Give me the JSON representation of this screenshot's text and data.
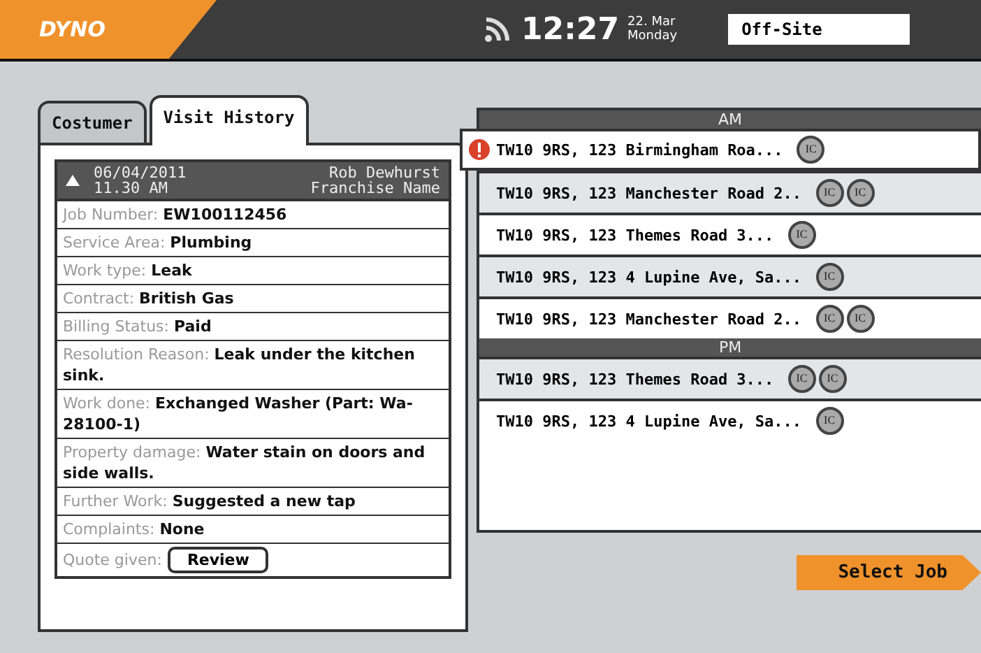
{
  "header": {
    "logo": "DYNO",
    "time": "12:27",
    "date": "22. Mar",
    "weekday": "Monday",
    "location": {
      "value": "Off-Site"
    }
  },
  "tabs": [
    {
      "label": "Costumer",
      "selected": false
    },
    {
      "label": "Visit History",
      "selected": true
    }
  ],
  "visit": {
    "expanded": true,
    "date": "06/04/2011",
    "time": "11.30 AM",
    "technician": "Rob Dewhurst",
    "franchise": "Franchise Name",
    "fields": [
      {
        "kind": "text",
        "label": "Job Number:",
        "value": "EW100112456"
      },
      {
        "kind": "text",
        "label": "Service Area:",
        "value": "Plumbing"
      },
      {
        "kind": "text",
        "label": "Work type:",
        "value": "Leak"
      },
      {
        "kind": "text",
        "label": "Contract:",
        "value": "British Gas"
      },
      {
        "kind": "text",
        "label": "Billing Status:",
        "value": "Paid"
      },
      {
        "kind": "text",
        "label": "Resolution Reason:",
        "value": "Leak under the kitchen sink."
      },
      {
        "kind": "text",
        "label": "Work done:",
        "value": "Exchanged Washer (Part: Wa-28100-1)"
      },
      {
        "kind": "text",
        "label": "Property damage:",
        "value": "Water stain on doors and side walls."
      },
      {
        "kind": "text",
        "label": "Further Work:",
        "value": "Suggested a new tap"
      },
      {
        "kind": "text",
        "label": "Complaints:",
        "value": "None"
      },
      {
        "kind": "button",
        "label": "Quote given:",
        "value": "Review"
      }
    ]
  },
  "jobs": [
    {
      "section": "AM",
      "rows": [
        {
          "address": "TW10 9RS, 123 Birmingham Roa...",
          "selected": true,
          "alert": true,
          "badges": [
            "IC"
          ]
        },
        {
          "address": "TW10 9RS, 123 Manchester Road 2..",
          "selected": false,
          "alert": false,
          "badges": [
            "IC",
            "IC"
          ]
        },
        {
          "address": "TW10 9RS, 123 Themes Road 3...",
          "selected": false,
          "alert": false,
          "badges": [
            "IC"
          ]
        },
        {
          "address": "TW10 9RS, 123 4 Lupine Ave, Sa...",
          "selected": false,
          "alert": false,
          "badges": [
            "IC"
          ]
        },
        {
          "address": "TW10 9RS, 123 Manchester Road 2..",
          "selected": false,
          "alert": false,
          "badges": [
            "IC",
            "IC"
          ]
        }
      ]
    },
    {
      "section": "PM",
      "rows": [
        {
          "address": "TW10 9RS, 123 Themes Road 3...",
          "selected": false,
          "alert": false,
          "badges": [
            "IC",
            "IC"
          ]
        },
        {
          "address": "TW10 9RS, 123 4 Lupine Ave, Sa...",
          "selected": false,
          "alert": false,
          "badges": [
            "IC"
          ]
        }
      ]
    }
  ],
  "select_button": "Select Job"
}
